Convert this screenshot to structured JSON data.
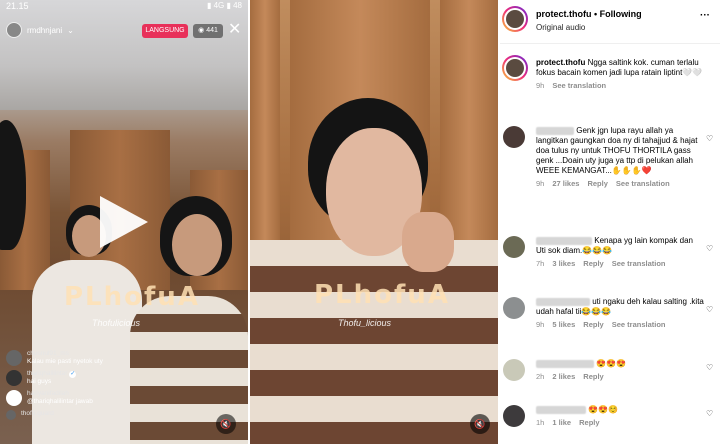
{
  "live": {
    "status_time": "21.15",
    "status_icons": "▮ 4G ▮ 48",
    "host_name": "rmdhnjani",
    "live_badge": "LANGSUNG",
    "viewer_count": "441",
    "watermark": "PLhofuA",
    "watermark_sub": "Thofulicious",
    "comments": [
      {
        "user": "chusnul91_ms",
        "text": "Kalau mie pasti nyetok uty"
      },
      {
        "user": "thariqhalilintar",
        "text": "hai guys",
        "verified": true
      },
      {
        "user": "hariyanifadilah",
        "text": "@thariqhalilintar  jawab"
      },
      {
        "user": "thofu.guard",
        "text": ""
      }
    ]
  },
  "middle": {
    "watermark": "PLhofuA",
    "watermark_sub": "Thofu_licious"
  },
  "post": {
    "username": "protect.thofu",
    "follow_label": "Following",
    "audio": "Original audio",
    "caption_user": "protect.thofu",
    "caption_text": "Ngga saltink kok. cuman terlalu fokus bacain komen jadi lupa ratain liptint🤍🤍",
    "caption_time": "9h",
    "caption_translate": "See translation",
    "comments": [
      {
        "text": "Genk jgn lupa rayu allah ya langitkan gaungkan doa ny di tahajjud & hajat doa tulus ny untuk THOFU THORTILA gass genk ...Doain uty juga ya ttp di pelukan allah WEEE KEMANGAT...✋✋✋❤️",
        "time": "9h",
        "likes": "27 likes",
        "reply": "Reply",
        "translate": "See translation"
      },
      {
        "text": "Kenapa yg lain kompak dan Uti sok diam.😂😂😂",
        "time": "7h",
        "likes": "3 likes",
        "reply": "Reply",
        "translate": "See translation"
      },
      {
        "text": "uti ngaku deh kalau salting .kita udah hafal tii😂😂😂",
        "time": "9h",
        "likes": "5 likes",
        "reply": "Reply",
        "translate": "See translation"
      },
      {
        "text": "😍😍😍",
        "time": "2h",
        "likes": "2 likes",
        "reply": "Reply",
        "translate": ""
      },
      {
        "text": "😍😍☺️",
        "time": "1h",
        "likes": "1 like",
        "reply": "Reply",
        "translate": ""
      }
    ]
  }
}
